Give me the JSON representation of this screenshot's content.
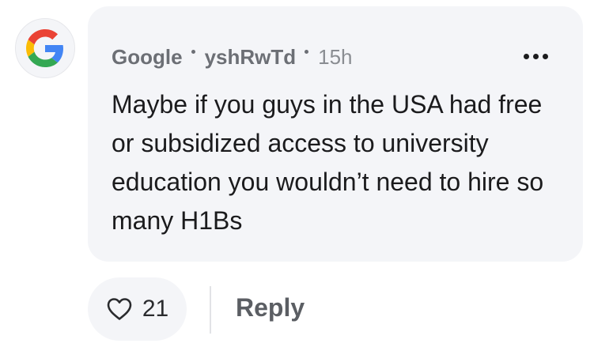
{
  "comment": {
    "author": "Google",
    "username": "yshRwTd",
    "time": "15h",
    "text": "Maybe if you guys in the USA had free or subsidized access to university education you wouldn’t need to hire so many H1Bs"
  },
  "actions": {
    "like_count": "21",
    "reply_label": "Reply"
  },
  "icons": {
    "avatar": "google-logo",
    "more": "more-options-icon",
    "like": "heart-outline-icon"
  },
  "colors": {
    "bubble_bg": "#f4f5f8",
    "google_blue": "#4285F4",
    "google_red": "#EA4335",
    "google_yellow": "#FBBC05",
    "google_green": "#34A853"
  }
}
